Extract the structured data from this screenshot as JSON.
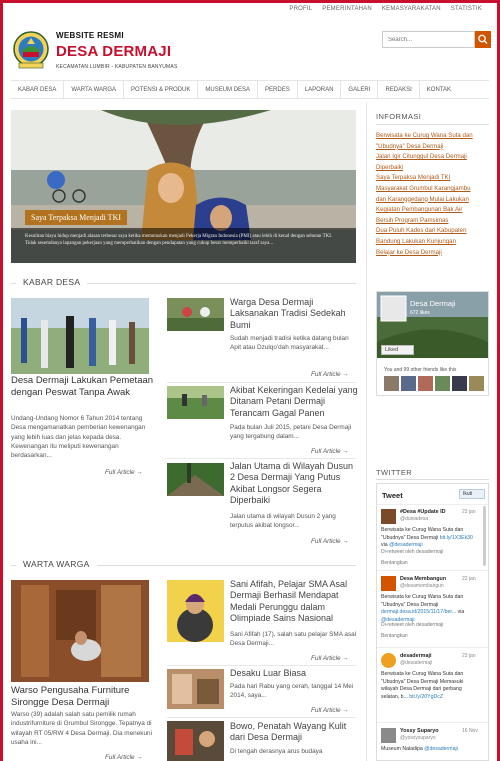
{
  "topnav": [
    "PROFIL",
    "PEMERINTAHAN",
    "KEMASYARAKATAN",
    "STATISTIK"
  ],
  "header": {
    "kicker": "WEBSITE RESMI",
    "title": "DESA DERMAJI",
    "subtitle": "KECAMATAN LUMBIR - KABUPATEN BANYUMAS"
  },
  "search": {
    "placeholder": "Search..."
  },
  "mainnav": [
    "KABAR DESA",
    "WARTA WARGA",
    "POTENSI & PRODUK",
    "MUSEUM DESA",
    "PERDES",
    "LAPORAN",
    "GALERI",
    "REDAKSI",
    "KONTAK"
  ],
  "slider": {
    "caption": "Saya Terpaksa Menjadi TKI",
    "description": "Kesulitan biaya hidup menjadi alasan terbesar saya ketika memutuskan menjadi Pekerja Migran Indonesia (PMI) atau lebih di kenal dengan sebutan TKI. Tidak sesemdanya lapangan pekerjaan yang memperhatikan dengan pendapatan yang cukup besar memperbaiki taraf saya..."
  },
  "kabar_desa": {
    "heading": "KABAR DESA",
    "lead": {
      "title": "Desa Dermaji Lakukan Pemetaan dengan Peswat Tanpa Awak",
      "excerpt": "Undang-Undang Nomor 6 Tahun 2014 tentang Desa mengamanatkan pemberian kewenangan yang lebih luas dan jelas kepada desa. Kewenangan itu meliputi kewenangan berdasarkan...",
      "more": "Full Article →"
    },
    "items": [
      {
        "title": "Warga Desa Dermaji Laksanakan Tradisi Sedekah Bumi",
        "excerpt": "Sudah menjadi tradisi ketika datang bulan Apit atau Dzulqo'dah masyarakat...",
        "more": "Full Article →"
      },
      {
        "title": "Akibat Kekeringan Kedelai yang Ditanam Petani Dermaji Terancam Gagal Panen",
        "excerpt": "Pada bulan Juli 2015, petani Desa Dermaji yang tergabung dalam...",
        "more": "Full Article →"
      },
      {
        "title": "Jalan Utama di Wilayah Dusun 2 Desa Dermaji Yang Putus Akibat Longsor Segera Diperbaiki",
        "excerpt": "Jalan utama di wilayah Dusun 2 yang terputus akibat longsor...",
        "more": "Full Article →"
      }
    ]
  },
  "warta_warga": {
    "heading": "WARTA WARGA",
    "lead": {
      "title": "Warso Pengusaha Furniture Sirongge Desa Dermaji",
      "excerpt": "Warso (39) adalah salah satu pemilik rumah industrifurniture di Grumbul Sirongge. Tepatnya di wilayah RT 05/RW 4 Desa Dermaji. Dia menekuni usaha ini...",
      "more": "Full Article →"
    },
    "items": [
      {
        "title": "Sani Afifah, Pelajar SMA Asal Dermaji Berhasil Mendapat Medali Perunggu dalam Olimpiade Sains Nasional",
        "excerpt": "Sani Afifah (17), salah satu pelajar SMA asal Desa Dermaji...",
        "more": "Full Article →"
      },
      {
        "title": "Desaku Luar Biasa",
        "excerpt": "Pada hari Rabu yang cerah, tanggal 14 Mei 2014, saya...",
        "more": "Full Article →"
      },
      {
        "title": "Bowo, Penatah Wayang Kulit dari Desa Dermaji",
        "excerpt": "Di tengah derasnya arus budaya",
        "more": ""
      }
    ]
  },
  "sidebar": {
    "info_heading": "INFORMASI",
    "info_links": [
      "Berwisata ke Curug Wana Suta dan",
      "\"Ubudnya\" Desa Dermaji",
      "Jalan Igir Citunggul Desa Dermaji",
      "Diperbaiki",
      "Saya Terpaksa Menjadi TKI",
      "Masyarakat Grumbul Karangjambu",
      "dan Karanggedang Mulai Lakukan",
      "Kegiatan Pembangunan Bak Air",
      "Bersih Program Pamsimas",
      "Dua Puluh Kades dari Kabupaten",
      "Bandung Lakukan Kunjungan",
      "Belajar ke Desa Dermaji"
    ],
    "facebook": {
      "name": "Desa Dermaji",
      "likes": "672 likes",
      "liked_label": "Liked",
      "friends": "You and 99 other friends like this"
    },
    "twitter_heading": "TWITTER",
    "twitter": {
      "tweet_label": "Tweet",
      "follow_label": "Ikuti",
      "tweets": [
        {
          "name": "#Desa #Update ID",
          "handle": "@duniadesa",
          "date": "23 jan",
          "text": "Berwisata ke Curug Wana Suta dan \"Ubudnya\" Desa Dermaji",
          "link": "bit.ly/1X3Ek30",
          "via": "via",
          "via_handle": "@desadermaji",
          "retweet": "Di-retweet oleh desadermaji",
          "location": "Bentangkan"
        },
        {
          "name": "Desa Membangun",
          "handle": "@desamembangun",
          "date": "22 jan",
          "text": "Berwisata ke Curug Wana Suta dan \"Ubudnya\" Desa Dermaji",
          "link": "dermaji.desa.id/2015/11/17/ber...",
          "via": "via",
          "via_handle": "@desadermaji",
          "retweet": "Di-retweet oleh desadermaji",
          "location": "Bentangkan"
        },
        {
          "name": "desadermaji",
          "handle": "@desadermaji",
          "date": "23 jan",
          "text": "Berwisata ke Curug Wana Suta dan \"Ubudnya\" Desa Dermaji Memasuki wilayah Desa Dermaji dari gerbang selatan, b...",
          "link": "bit.ly/20YgDcZ",
          "via": "",
          "via_handle": "",
          "retweet": "",
          "location": ""
        },
        {
          "name": "Yossy Suparyo",
          "handle": "@yossysuparyo",
          "date": "16 Nov",
          "text": "Museum Naladipa",
          "link": "",
          "via": "",
          "via_handle": "@desadermaji",
          "retweet": "",
          "location": ""
        }
      ]
    }
  },
  "colors": {
    "brand_red": "#c8102e",
    "accent_orange": "#d35400",
    "link_brown": "#b05a1a"
  }
}
